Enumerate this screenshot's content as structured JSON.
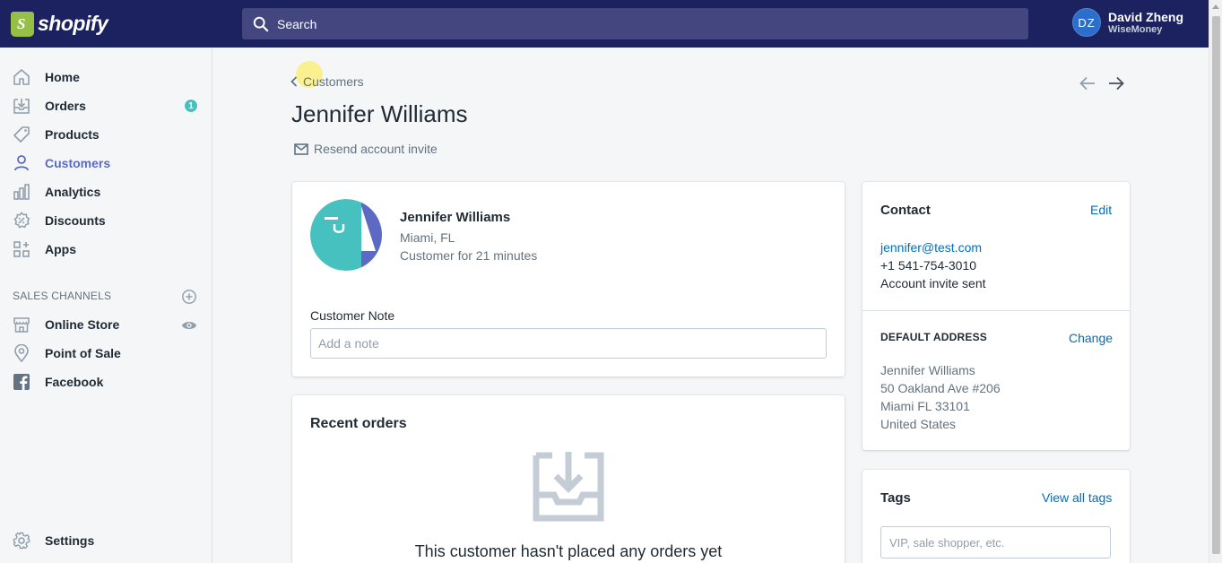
{
  "brand": {
    "name": "shopify",
    "color": "#95bf47"
  },
  "topbar": {
    "search_label": "Search",
    "user": {
      "initials": "DZ",
      "name": "David Zheng",
      "store": "WiseMoney"
    }
  },
  "sidebar": {
    "items": [
      {
        "label": "Home",
        "icon": "home-icon"
      },
      {
        "label": "Orders",
        "icon": "orders-icon",
        "badge": "1"
      },
      {
        "label": "Products",
        "icon": "tag-icon"
      },
      {
        "label": "Customers",
        "icon": "person-icon",
        "active": true
      },
      {
        "label": "Analytics",
        "icon": "bar-chart-icon"
      },
      {
        "label": "Discounts",
        "icon": "discount-icon"
      },
      {
        "label": "Apps",
        "icon": "apps-icon"
      }
    ],
    "sales_channels_title": "SALES CHANNELS",
    "channels": [
      {
        "label": "Online Store",
        "icon": "store-icon"
      },
      {
        "label": "Point of Sale",
        "icon": "location-pin-icon"
      },
      {
        "label": "Facebook",
        "icon": "facebook-icon"
      }
    ],
    "settings_label": "Settings"
  },
  "page": {
    "breadcrumb": "Customers",
    "title": "Jennifer Williams",
    "resend_label": "Resend account invite"
  },
  "customer_card": {
    "name": "Jennifer Williams",
    "location": "Miami, FL",
    "customer_since": "Customer for 21 minutes",
    "note_label": "Customer Note",
    "note_placeholder": "Add a note"
  },
  "orders_card": {
    "heading": "Recent orders",
    "empty_text": "This customer hasn't placed any orders yet"
  },
  "contact_card": {
    "heading": "Contact",
    "edit_label": "Edit",
    "email": "jennifer@test.com",
    "phone": "+1 541-754-3010",
    "invite_status": "Account invite sent",
    "address_heading": "DEFAULT ADDRESS",
    "change_label": "Change",
    "address": [
      "Jennifer Williams",
      "50 Oakland Ave #206",
      "Miami FL 33101",
      "United States"
    ]
  },
  "tags_card": {
    "heading": "Tags",
    "view_all_label": "View all tags",
    "placeholder": "VIP, sale shopper, etc."
  },
  "colors": {
    "topbar": "#1c2260",
    "accent": "#5c6ac4",
    "link": "#006fbb",
    "badge": "#47c1bf"
  }
}
